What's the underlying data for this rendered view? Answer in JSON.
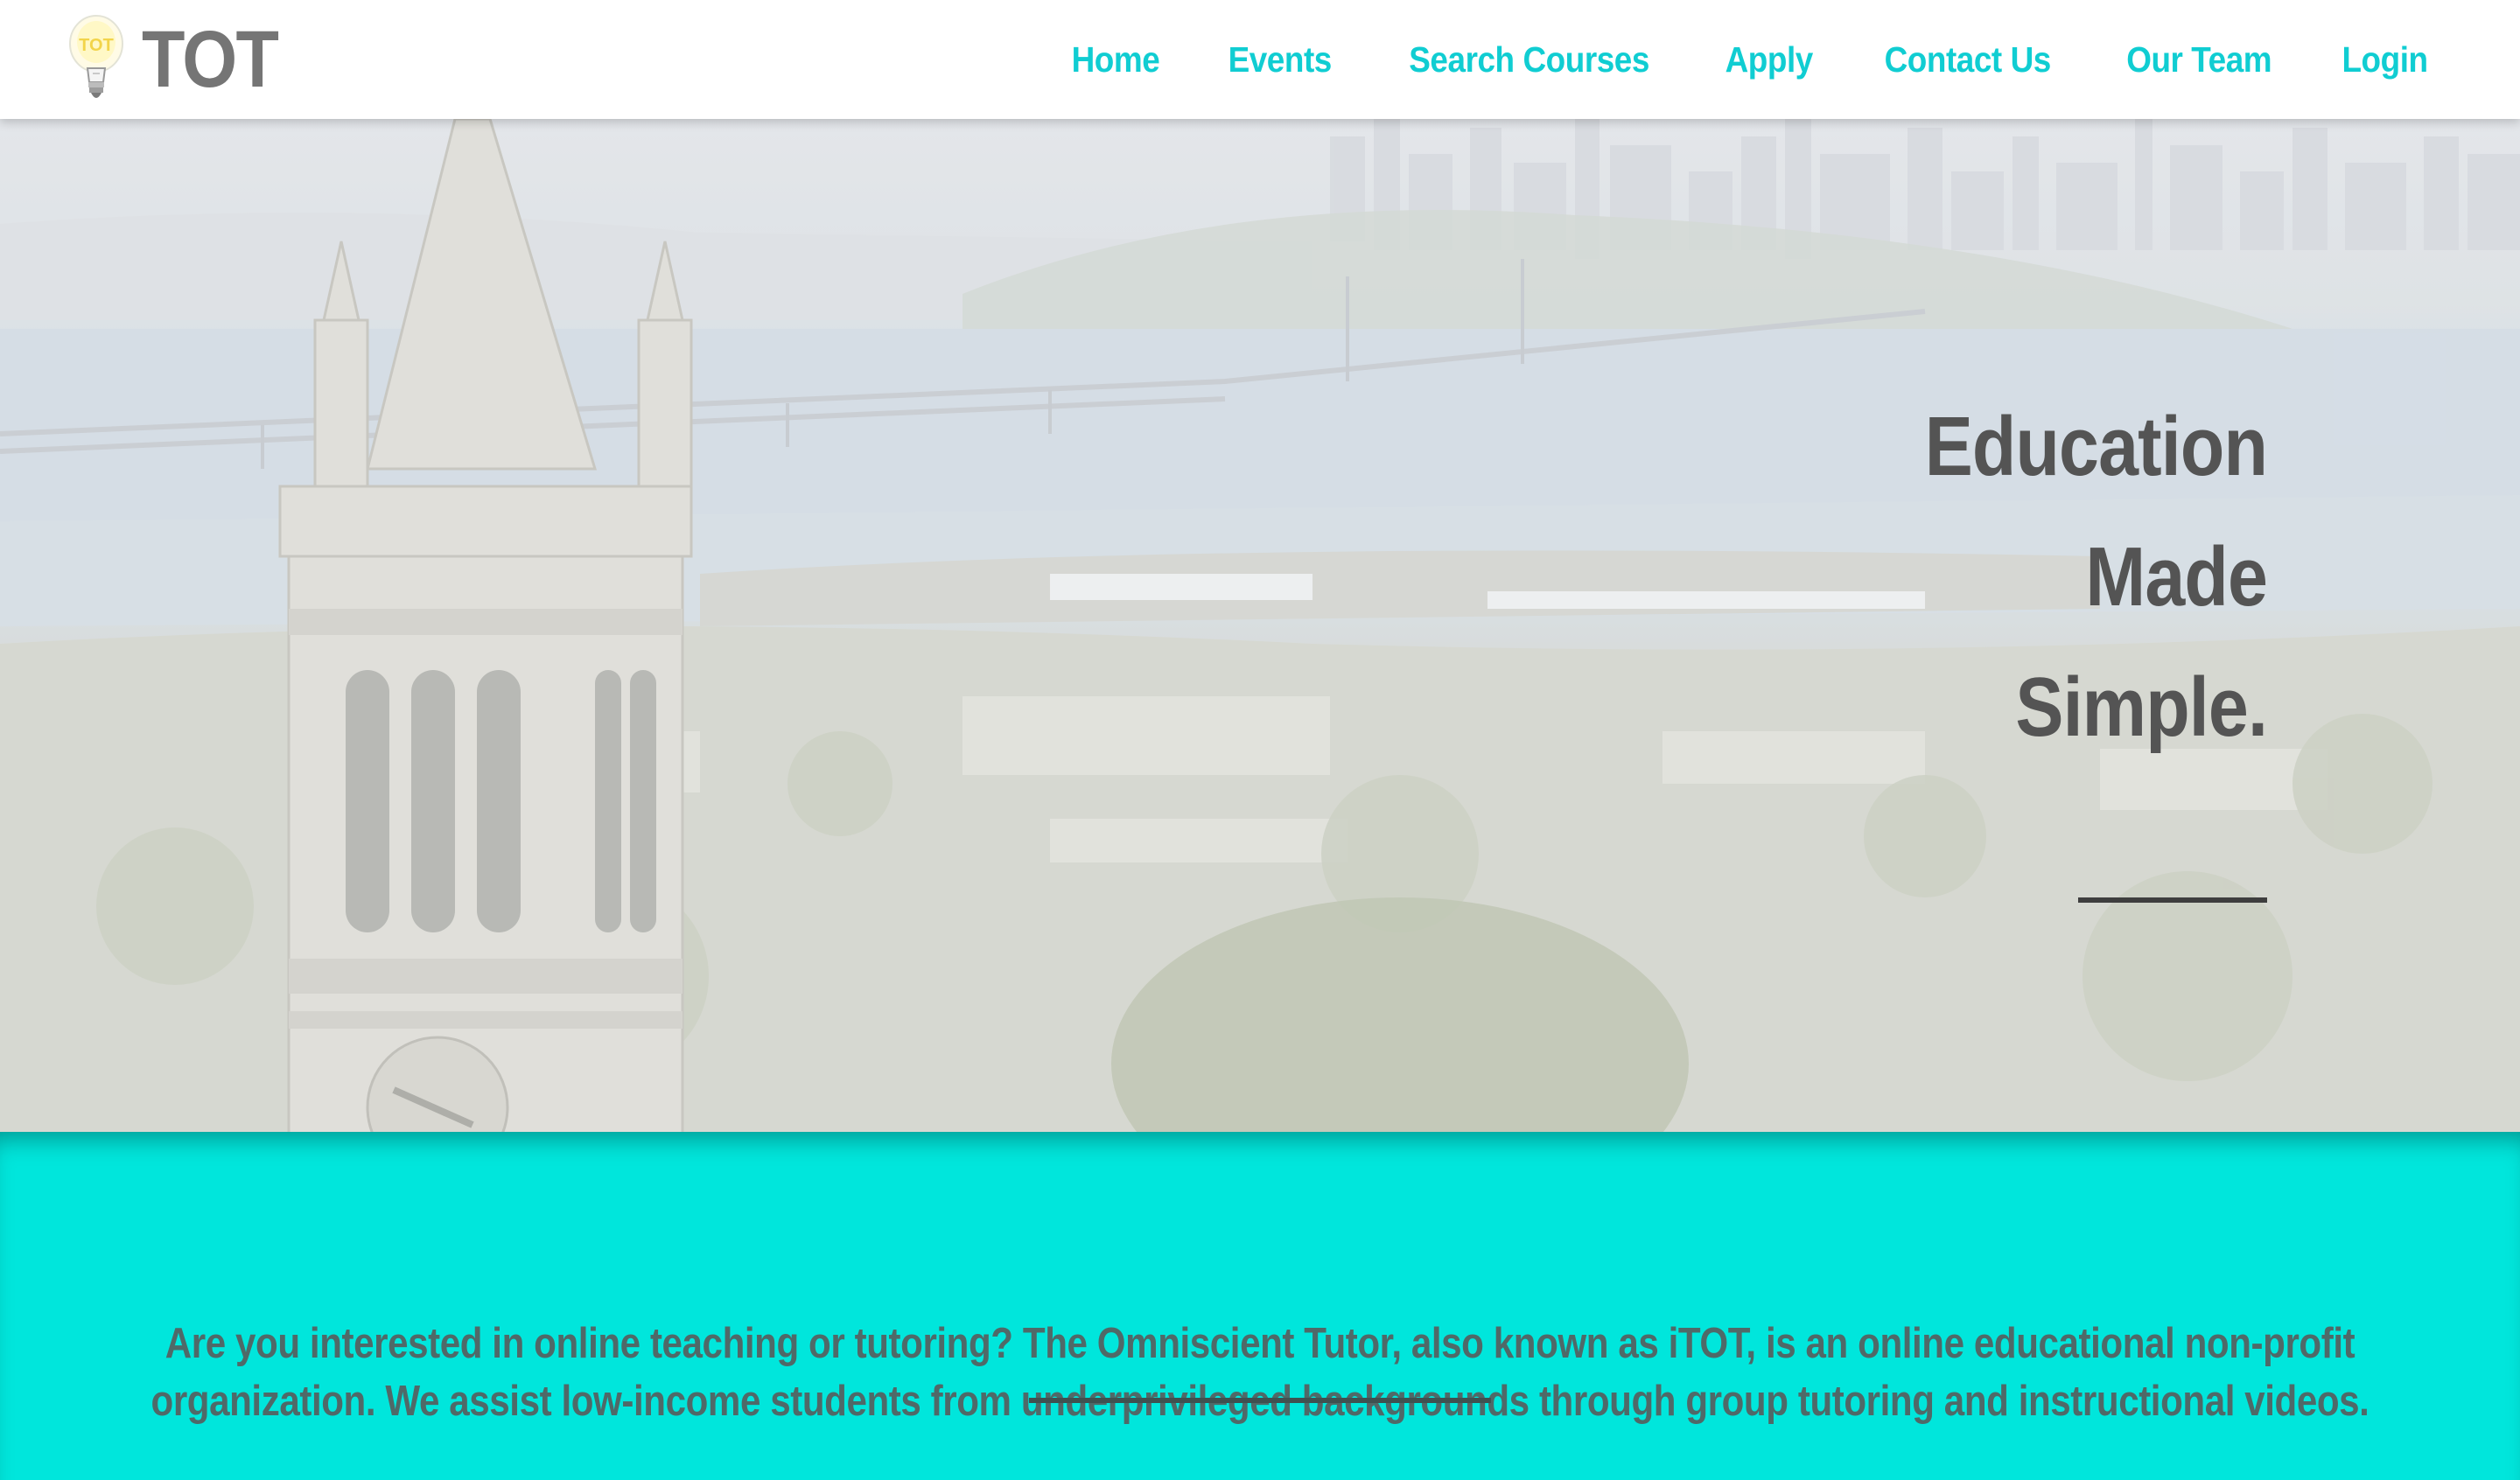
{
  "brand": {
    "name": "TOT",
    "icon": "lightbulb-icon",
    "bulb_text": "TOT"
  },
  "nav": {
    "items": [
      {
        "label": "Home"
      },
      {
        "label": "Events"
      },
      {
        "label": "Search Courses"
      },
      {
        "label": "Apply"
      },
      {
        "label": "Contact Us"
      },
      {
        "label": "Our Team"
      },
      {
        "label": "Login"
      }
    ],
    "color": "#10cdd2"
  },
  "hero": {
    "tagline": [
      "Education",
      "Made",
      "Simple."
    ],
    "background": "campus-tower-bay-photo"
  },
  "intro": {
    "text": "Are you interested in online teaching or tutoring? The Omniscient Tutor, also known as iTOT, is an online educational non-profit organization. We assist low-income students from underprivileged backgrounds through group tutoring and instructional videos.",
    "background_color": "#00e6dc"
  }
}
